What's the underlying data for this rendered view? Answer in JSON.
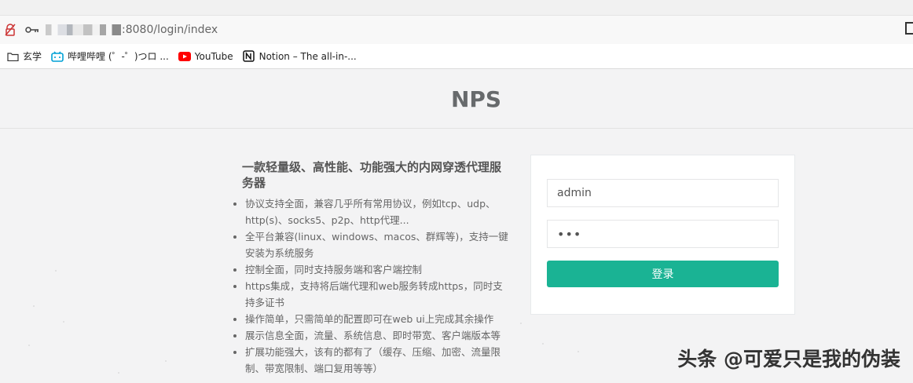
{
  "browser": {
    "url_suffix": ":8080/login/index",
    "bookmarks": [
      {
        "label": "玄学",
        "icon": "folder-icon"
      },
      {
        "label": "哔哩哔哩 (゜-゜)つロ ...",
        "icon": "bilibili-icon"
      },
      {
        "label": "YouTube",
        "icon": "youtube-icon"
      },
      {
        "label": "Notion – The all-in-...",
        "icon": "notion-icon"
      }
    ]
  },
  "page": {
    "brand": "NPS",
    "intro_title": "一款轻量级、高性能、功能强大的内网穿透代理服务器",
    "features": [
      "协议支持全面，兼容几乎所有常用协议，例如tcp、udp、http(s)、socks5、p2p、http代理...",
      "全平台兼容(linux、windows、macos、群辉等)，支持一键安装为系统服务",
      "控制全面，同时支持服务端和客户端控制",
      "https集成，支持将后端代理和web服务转成https，同时支持多证书",
      "操作简单，只需简单的配置即可在web ui上完成其余操作",
      "展示信息全面，流量、系统信息、即时带宽、客户端版本等",
      "扩展功能强大，该有的都有了（缓存、压缩、加密、流量限制、带宽限制、端口复用等等）"
    ]
  },
  "login": {
    "username_value": "admin",
    "password_value": "•••",
    "submit_label": "登录"
  },
  "watermark": "头条 @可爱只是我的伪装"
}
